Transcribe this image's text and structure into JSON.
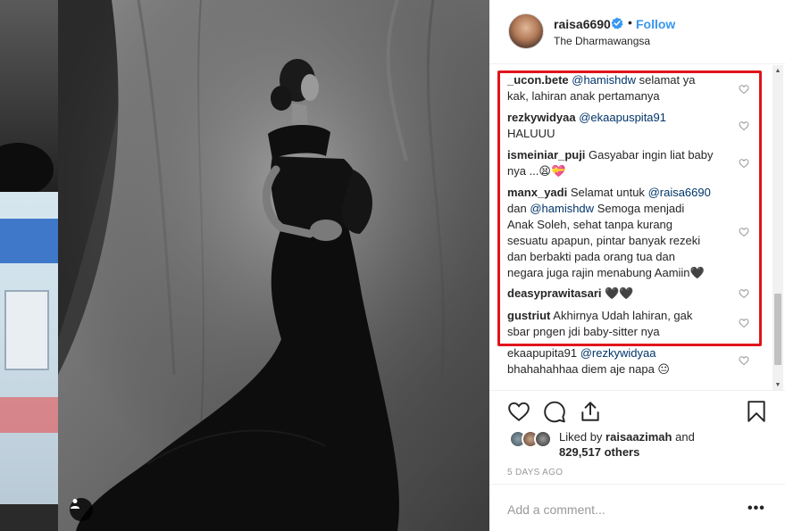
{
  "post": {
    "username": "raisa6690",
    "dot": "•",
    "follow_label": "Follow",
    "location": "The Dharmawangsa"
  },
  "comments": [
    {
      "user": "_ucon.bete",
      "mention": "@hamishdw",
      "text_after": " selamat ya kak, lahiran anak pertamanya",
      "line1": "selamat ya",
      "line2": "kak, lahiran anak pertamanya"
    },
    {
      "user": "rezkywidyaa",
      "mention": "@ekaapuspita91",
      "line2": "HALUUU"
    },
    {
      "user": "ismeiniar_puji",
      "line1": "Gasyabar ingin liat baby",
      "line2": "nya ...😫💝"
    },
    {
      "user": "manx_yadi",
      "line1": "Selamat untuk",
      "mention": "@raisa6690",
      "line2a": "dan",
      "mention2": "@hamishdw",
      "line2b": "Semoga menjadi",
      "line3": "Anak Soleh, sehat tanpa kurang",
      "line4": "sesuatu apapun, pintar banyak rezeki",
      "line5": "dan berbakti pada orang tua dan",
      "line6": "negara juga rajin menabung Aamiin🖤"
    },
    {
      "user": "deasyprawitasari",
      "line1": "🖤🖤"
    },
    {
      "user": "gustriut",
      "line1": "Akhirnya Udah lahiran, gak",
      "line2": "sbar pngen jdi baby-sitter nya"
    },
    {
      "user": "ekaapupita91",
      "mention": "@rezkywidyaa",
      "line2": "bhahahahhaa diem aje napa 😐"
    }
  ],
  "likes": {
    "prefix": "Liked by",
    "user": "raisaazimah",
    "and": "and",
    "count_text": "829,517 others"
  },
  "timestamp": "5 DAYS AGO",
  "add_comment_placeholder": "Add a comment...",
  "more_label": "•••",
  "colors": {
    "accent_blue": "#3897f0",
    "mention": "#003569",
    "highlight_red": "#e0141c"
  },
  "icons": [
    "verified-badge-icon",
    "heart-icon",
    "comment-icon",
    "share-icon",
    "bookmark-icon",
    "user-tag-icon",
    "more-options-icon"
  ]
}
